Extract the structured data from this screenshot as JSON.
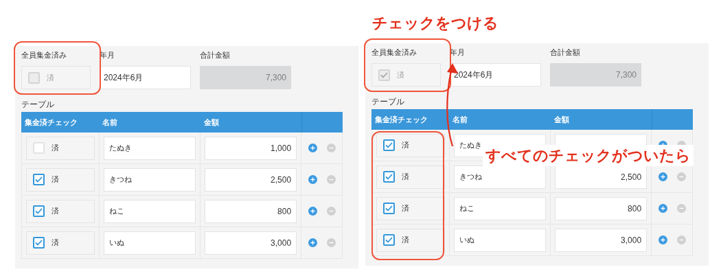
{
  "panels": [
    {
      "fields": [
        {
          "kind": "checkbox",
          "label": "全員集金済み",
          "option": "済",
          "checked": false,
          "disabled": true,
          "highlighted": true
        },
        {
          "kind": "text",
          "label": "年月",
          "value": "2024年6月"
        },
        {
          "kind": "calc",
          "label": "合計金額",
          "value": "7,300"
        }
      ],
      "table": {
        "label": "テーブル",
        "columns": [
          "集金済チェック",
          "名前",
          "金額"
        ],
        "highlighted": false,
        "rows": [
          {
            "checked": false,
            "option": "済",
            "name": "たぬき",
            "amount": "1,000"
          },
          {
            "checked": true,
            "option": "済",
            "name": "きつね",
            "amount": "2,500"
          },
          {
            "checked": true,
            "option": "済",
            "name": "ねこ",
            "amount": "800"
          },
          {
            "checked": true,
            "option": "済",
            "name": "いぬ",
            "amount": "3,000"
          }
        ]
      }
    },
    {
      "heading": "チェックをつける",
      "fields": [
        {
          "kind": "checkbox",
          "label": "全員集金済み",
          "option": "済",
          "checked": true,
          "disabled": true,
          "highlighted": true
        },
        {
          "kind": "text",
          "label": "年月",
          "value": "2024年6月"
        },
        {
          "kind": "calc",
          "label": "合計金額",
          "value": "7,300"
        }
      ],
      "table": {
        "label": "テーブル",
        "columns": [
          "集金済チェック",
          "名前",
          "金額"
        ],
        "highlighted": true,
        "rows": [
          {
            "checked": true,
            "option": "済",
            "name": "たぬき"
          },
          {
            "checked": true,
            "option": "済",
            "name": "きつね",
            "amount": "2,500"
          },
          {
            "checked": true,
            "option": "済",
            "name": "ねこ",
            "amount": "800"
          },
          {
            "checked": true,
            "option": "済",
            "name": "いぬ",
            "amount": "3,000"
          }
        ]
      },
      "callout": "すべてのチェックがついたら"
    }
  ]
}
